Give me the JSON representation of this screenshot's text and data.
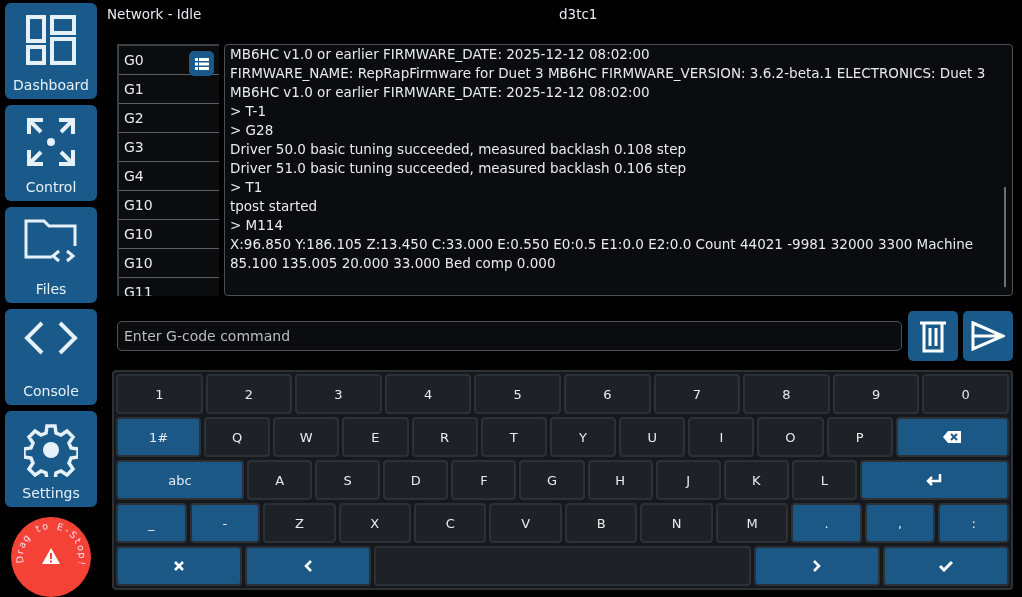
{
  "nav": [
    {
      "label": "Dashboard",
      "kind": "dashboard"
    },
    {
      "label": "Control",
      "kind": "control"
    },
    {
      "label": "Files",
      "kind": "files"
    },
    {
      "label": "Console",
      "kind": "console"
    },
    {
      "label": "Settings",
      "kind": "settings"
    }
  ],
  "estop": {
    "label": "Drag to E-Stop!"
  },
  "header": {
    "status": "Network - Idle",
    "machine": "d3tc1"
  },
  "history": [
    "G0",
    "G1",
    "G2",
    "G3",
    "G4",
    "G10",
    "G10",
    "G10",
    "G11"
  ],
  "console_lines": [
    "MB6HC v1.0 or earlier FIRMWARE_DATE: 2025-12-12 08:02:00",
    "FIRMWARE_NAME: RepRapFirmware for Duet 3 MB6HC FIRMWARE_VERSION: 3.6.2-beta.1 ELECTRONICS: Duet 3 MB6HC v1.0 or earlier FIRMWARE_DATE: 2025-12-12 08:02:00",
    "> T-1",
    "> G28",
    "Driver 50.0 basic tuning succeeded, measured backlash 0.108 step",
    "Driver 51.0 basic tuning succeeded, measured backlash 0.106 step",
    "> T1",
    "tpost started",
    "> M114",
    "X:96.850 Y:186.105 Z:13.450 C:33.000 E:0.550 E0:0.5 E1:0.0 E2:0.0 Count 44021 -9981 32000 3300 Machine 85.100 135.005 20.000 33.000 Bed comp 0.000"
  ],
  "command": {
    "placeholder": "Enter G-code command"
  },
  "keyboard": [
    [
      {
        "label": "1",
        "kind": "char"
      },
      {
        "label": "2",
        "kind": "char"
      },
      {
        "label": "3",
        "kind": "char"
      },
      {
        "label": "4",
        "kind": "char"
      },
      {
        "label": "5",
        "kind": "char"
      },
      {
        "label": "6",
        "kind": "char"
      },
      {
        "label": "7",
        "kind": "char"
      },
      {
        "label": "8",
        "kind": "char"
      },
      {
        "label": "9",
        "kind": "char"
      },
      {
        "label": "0",
        "kind": "char"
      }
    ],
    [
      {
        "label": "1#",
        "kind": "mode"
      },
      {
        "label": "Q",
        "kind": "char"
      },
      {
        "label": "W",
        "kind": "char"
      },
      {
        "label": "E",
        "kind": "char"
      },
      {
        "label": "R",
        "kind": "char"
      },
      {
        "label": "T",
        "kind": "char"
      },
      {
        "label": "Y",
        "kind": "char"
      },
      {
        "label": "U",
        "kind": "char"
      },
      {
        "label": "I",
        "kind": "char"
      },
      {
        "label": "O",
        "kind": "char"
      },
      {
        "label": "P",
        "kind": "char"
      },
      {
        "kind": "backspace"
      }
    ],
    [
      {
        "label": "abc",
        "kind": "mode"
      },
      {
        "label": "A",
        "kind": "char"
      },
      {
        "label": "S",
        "kind": "char"
      },
      {
        "label": "D",
        "kind": "char"
      },
      {
        "label": "F",
        "kind": "char"
      },
      {
        "label": "G",
        "kind": "char"
      },
      {
        "label": "H",
        "kind": "char"
      },
      {
        "label": "J",
        "kind": "char"
      },
      {
        "label": "K",
        "kind": "char"
      },
      {
        "label": "L",
        "kind": "char"
      },
      {
        "kind": "enter"
      }
    ],
    [
      {
        "label": "_",
        "kind": "symbol"
      },
      {
        "label": "-",
        "kind": "symbol"
      },
      {
        "label": "Z",
        "kind": "char"
      },
      {
        "label": "X",
        "kind": "char"
      },
      {
        "label": "C",
        "kind": "char"
      },
      {
        "label": "V",
        "kind": "char"
      },
      {
        "label": "B",
        "kind": "char"
      },
      {
        "label": "N",
        "kind": "char"
      },
      {
        "label": "M",
        "kind": "char"
      },
      {
        "label": ".",
        "kind": "symbol"
      },
      {
        "label": ",",
        "kind": "symbol"
      },
      {
        "label": ":",
        "kind": "symbol"
      }
    ],
    [
      {
        "kind": "close"
      },
      {
        "kind": "left"
      },
      {
        "kind": "space"
      },
      {
        "kind": "right"
      },
      {
        "kind": "accept"
      }
    ]
  ]
}
